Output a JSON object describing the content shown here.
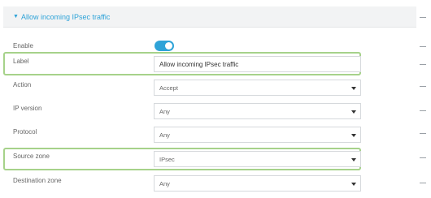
{
  "section": {
    "title": "Allow incoming IPsec traffic",
    "chevron_icon": "chevron-down-icon"
  },
  "colors": {
    "accent": "#2ea3d8",
    "highlight": "#a6d28a"
  },
  "fields": {
    "enable": {
      "label": "Enable",
      "value": "on"
    },
    "label": {
      "label": "Label",
      "value": "Allow incoming IPsec traffic"
    },
    "action": {
      "label": "Action",
      "value": "Accept"
    },
    "ip_version": {
      "label": "IP version",
      "value": "Any"
    },
    "protocol": {
      "label": "Protocol",
      "value": "Any"
    },
    "source_zone": {
      "label": "Source zone",
      "value": "IPsec"
    },
    "destination_zone": {
      "label": "Destination zone",
      "value": "Any"
    }
  }
}
